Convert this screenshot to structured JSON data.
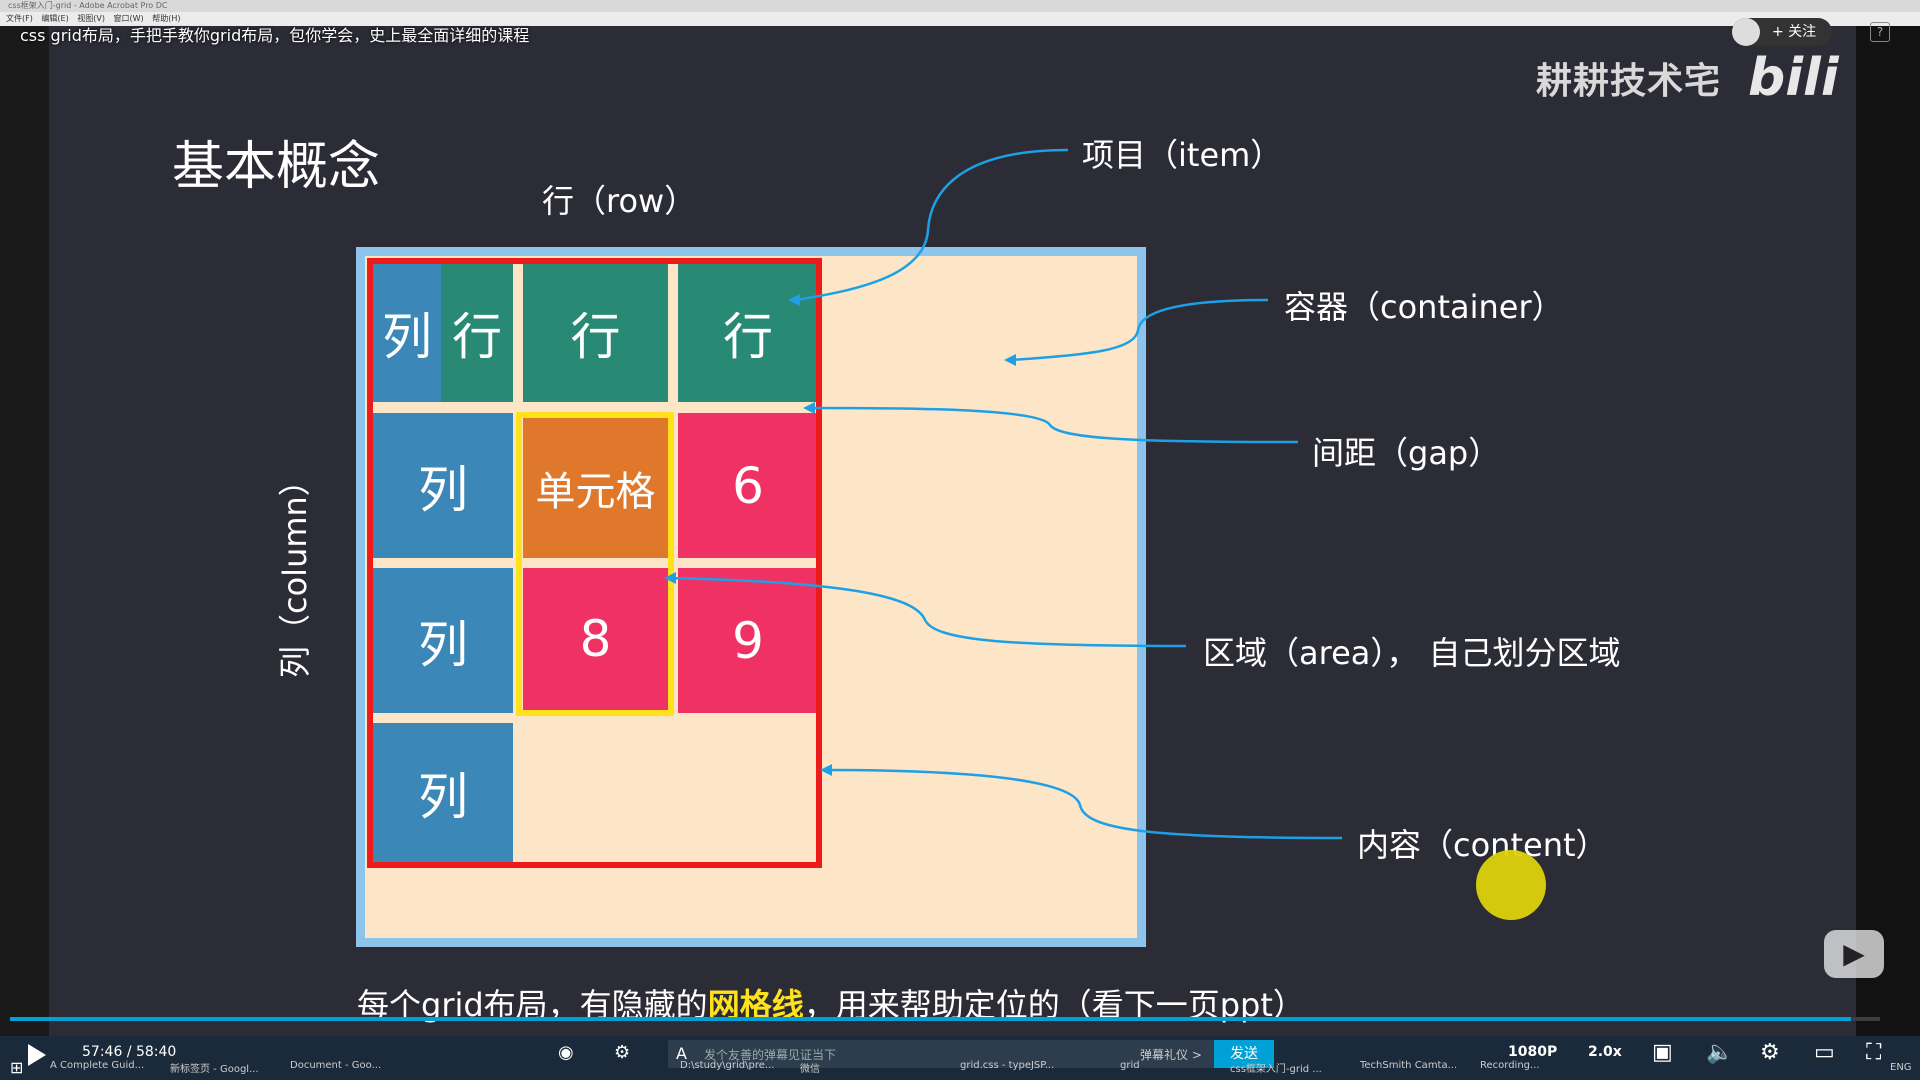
{
  "window": {
    "title": "css框架入门-grid - Adobe Acrobat Pro DC",
    "menu": [
      "文件(F)",
      "编辑(E)",
      "视图(V)",
      "窗口(W)",
      "帮助(H)"
    ]
  },
  "video": {
    "title": "css grid布局，手把手教你grid布局，包你学会，史上最全面详细的课程",
    "follow_label": "+ 关注",
    "brand": "耕耕技术宅",
    "logo": "bilibili",
    "current_time": "57:46",
    "separator": "/",
    "duration": "58:40",
    "progress": 0.9847,
    "quality": "1080P",
    "speed": "2.0x",
    "danmaku_placeholder": "发个友善的弹幕见证当下",
    "danmaku_etiquette": "弹幕礼仪 >",
    "send_label": "发送",
    "help": "?"
  },
  "slide": {
    "title": "基本概念",
    "row_label": "行（row）",
    "column_label": "列（column）",
    "callouts": {
      "item": "项目（item）",
      "container": "容器（container）",
      "gap": "间距（gap）",
      "area": "区域（area），  自己划分区域",
      "content": "内容（content）"
    },
    "cells": {
      "r1c1_col": "列",
      "r1c1_row": "行",
      "r1c2": "行",
      "r1c3": "行",
      "r2c1": "列",
      "r2c2": "单元格",
      "r2c3": "6",
      "r3c1": "列",
      "r3c2": "8",
      "r3c3": "9",
      "r4c1": "列"
    },
    "footer_pre": "每个grid布局，有隐藏的",
    "footer_highlight": "网格线",
    "footer_post": "，用来帮助定位的（看下一页ppt）"
  },
  "taskbar": {
    "items": [
      "A Complete Guid...",
      "新标签页 - Googl...",
      "Document - Goo...",
      "D:\\study\\grid\\pre...",
      "微信",
      "grid.css - typeJSP...",
      "grid",
      "css框架入门-grid ...",
      "TechSmith Camta...",
      "Recording..."
    ],
    "tray": "ENG"
  },
  "colors": {
    "accent": "#00a1d6",
    "container_bg": "#fde6c7",
    "container_border": "#8ec4ec",
    "grid_border": "#ee1b1b",
    "area_border": "#ffe21c",
    "column_cell": "#3a87b8",
    "row_cell": "#288a74",
    "cell_orange": "#e0782c",
    "cell_pink": "#ef3263",
    "arrow": "#1ea0e6"
  }
}
